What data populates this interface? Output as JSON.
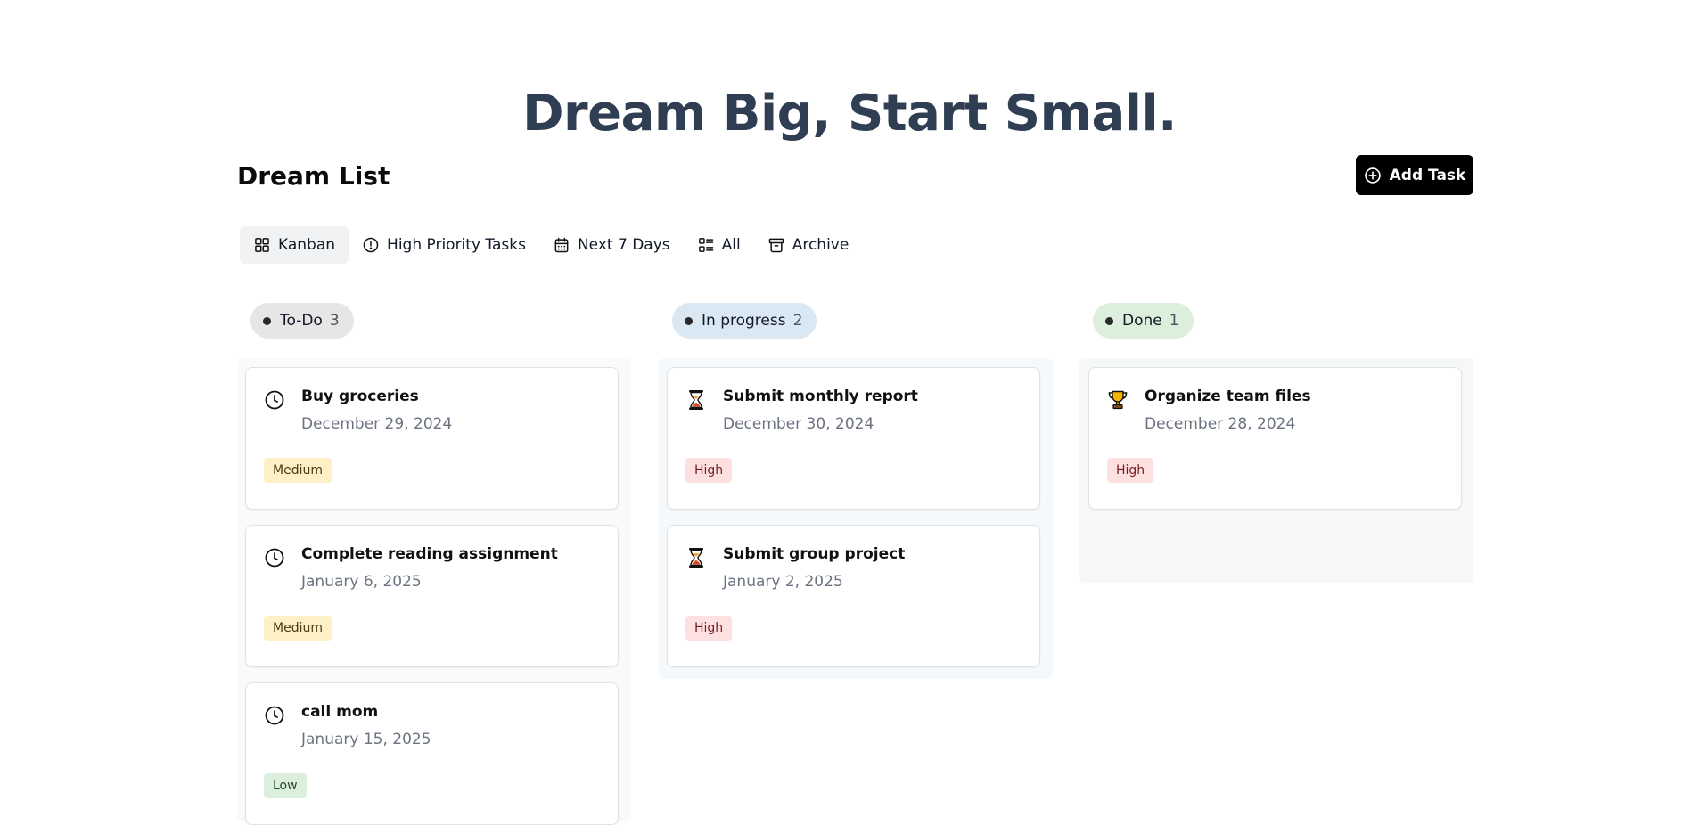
{
  "hero_title": "Dream Big, Start Small.",
  "list_title": "Dream List",
  "add_button": {
    "label": "Add Task",
    "icon": "plus-circle-icon"
  },
  "tabs": [
    {
      "label": "Kanban",
      "icon": "grid-icon",
      "active": true
    },
    {
      "label": "High Priority Tasks",
      "icon": "alert-circle-icon",
      "active": false
    },
    {
      "label": "Next 7 Days",
      "icon": "calendar-icon",
      "active": false
    },
    {
      "label": "All",
      "icon": "list-icon",
      "active": false
    },
    {
      "label": "Archive",
      "icon": "archive-icon",
      "active": false
    }
  ],
  "columns": [
    {
      "name": "To-Do",
      "count": "3",
      "color": "#e6e6e6",
      "bg": "#fafafa",
      "cards": [
        {
          "title": "Buy groceries",
          "date": "December 29, 2024",
          "priority": "Medium",
          "icon": "clock-icon"
        },
        {
          "title": "Complete reading assignment",
          "date": "January 6, 2025",
          "priority": "Medium",
          "icon": "clock-icon"
        },
        {
          "title": "call mom",
          "date": "January 15, 2025",
          "priority": "Low",
          "icon": "clock-icon"
        }
      ]
    },
    {
      "name": "In progress",
      "count": "2",
      "color": "#d9e8f2",
      "bg": "#f6f9fb",
      "cards": [
        {
          "title": "Submit monthly report",
          "date": "December 30, 2024",
          "priority": "High",
          "icon": "hourglass-icon"
        },
        {
          "title": "Submit group project",
          "date": "January 2, 2025",
          "priority": "High",
          "icon": "hourglass-icon"
        }
      ]
    },
    {
      "name": "Done",
      "count": "1",
      "color": "#dcefdc",
      "bg": "#f6f8f6",
      "cards": [
        {
          "title": "Organize team files",
          "date": "December 28, 2024",
          "priority": "High",
          "icon": "trophy-icon"
        }
      ]
    }
  ],
  "priority_colors": {
    "Medium": {
      "bg": "#fdf0c7",
      "fg": "#4a3b12"
    },
    "High": {
      "bg": "#fde0e0",
      "fg": "#7a1f1f"
    },
    "Low": {
      "bg": "#dcefdc",
      "fg": "#1f4a26"
    }
  }
}
